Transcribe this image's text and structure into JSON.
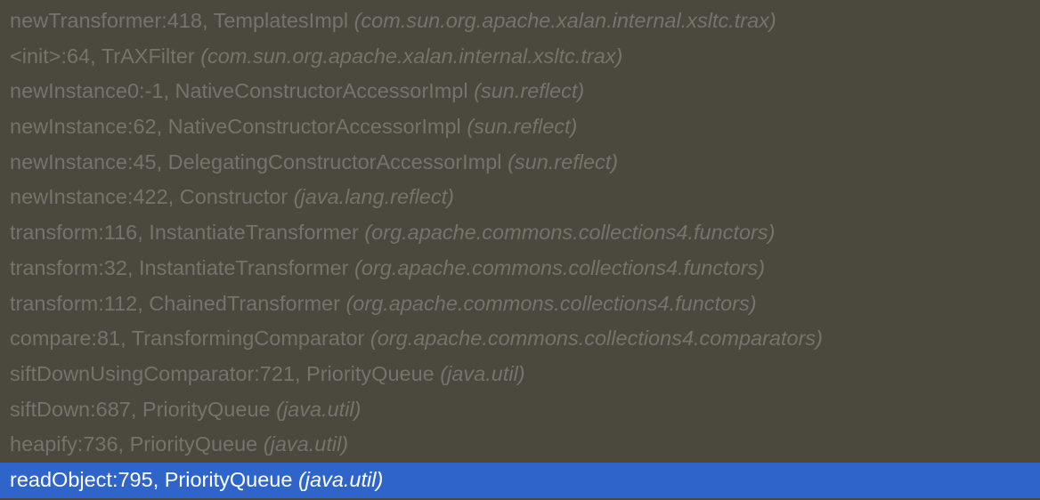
{
  "frames": [
    {
      "method": "newTransformer:418, TemplatesImpl",
      "package": "(com.sun.org.apache.xalan.internal.xsltc.trax)",
      "selected": false
    },
    {
      "method": "<init>:64, TrAXFilter",
      "package": "(com.sun.org.apache.xalan.internal.xsltc.trax)",
      "selected": false
    },
    {
      "method": "newInstance0:-1, NativeConstructorAccessorImpl",
      "package": "(sun.reflect)",
      "selected": false
    },
    {
      "method": "newInstance:62, NativeConstructorAccessorImpl",
      "package": "(sun.reflect)",
      "selected": false
    },
    {
      "method": "newInstance:45, DelegatingConstructorAccessorImpl",
      "package": "(sun.reflect)",
      "selected": false
    },
    {
      "method": "newInstance:422, Constructor",
      "package": "(java.lang.reflect)",
      "selected": false
    },
    {
      "method": "transform:116, InstantiateTransformer",
      "package": "(org.apache.commons.collections4.functors)",
      "selected": false
    },
    {
      "method": "transform:32, InstantiateTransformer",
      "package": "(org.apache.commons.collections4.functors)",
      "selected": false
    },
    {
      "method": "transform:112, ChainedTransformer",
      "package": "(org.apache.commons.collections4.functors)",
      "selected": false
    },
    {
      "method": "compare:81, TransformingComparator",
      "package": "(org.apache.commons.collections4.comparators)",
      "selected": false
    },
    {
      "method": "siftDownUsingComparator:721, PriorityQueue",
      "package": "(java.util)",
      "selected": false
    },
    {
      "method": "siftDown:687, PriorityQueue",
      "package": "(java.util)",
      "selected": false
    },
    {
      "method": "heapify:736, PriorityQueue",
      "package": "(java.util)",
      "selected": false
    },
    {
      "method": "readObject:795, PriorityQueue",
      "package": "(java.util)",
      "selected": true
    }
  ],
  "colors": {
    "background": "#4b483e",
    "frame_text": "#75736b",
    "selected_background": "#2f65ca",
    "selected_text": "#ffffff"
  }
}
